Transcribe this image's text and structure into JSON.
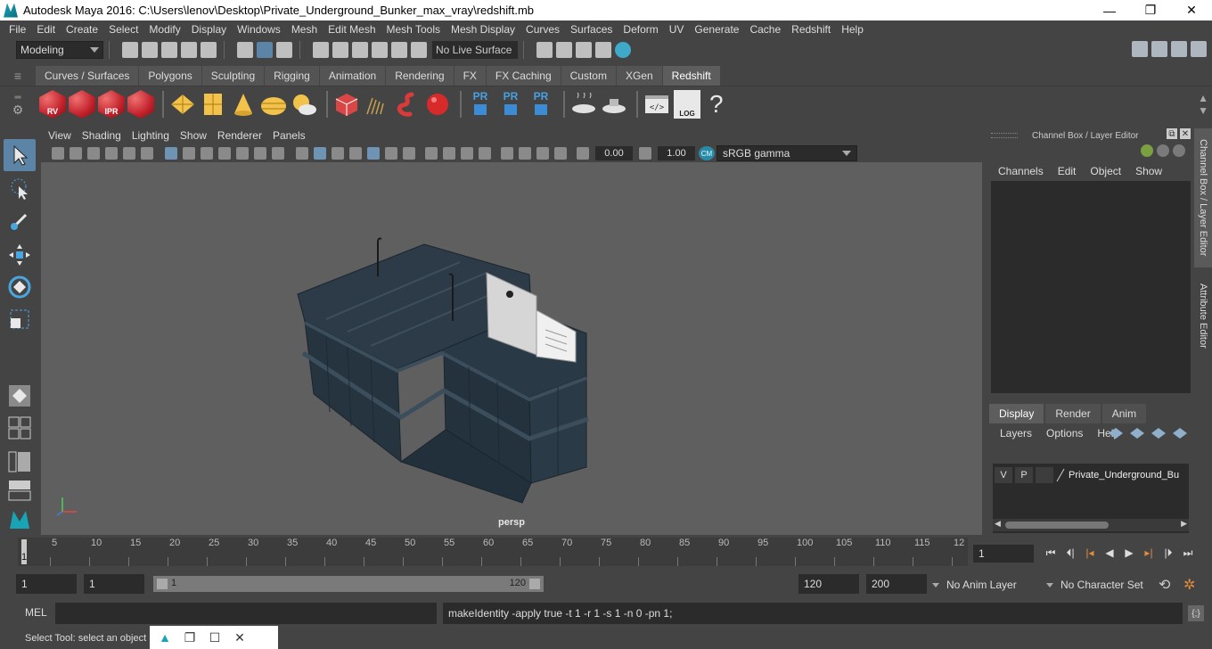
{
  "window": {
    "title": "Autodesk Maya 2016: C:\\Users\\lenov\\Desktop\\Private_Underground_Bunker_max_vray\\redshift.mb",
    "minimize": "—",
    "maximize": "❐",
    "close": "✕"
  },
  "menu": [
    "File",
    "Edit",
    "Create",
    "Select",
    "Modify",
    "Display",
    "Windows",
    "Mesh",
    "Edit Mesh",
    "Mesh Tools",
    "Mesh Display",
    "Curves",
    "Surfaces",
    "Deform",
    "UV",
    "Generate",
    "Cache",
    "Redshift",
    "Help"
  ],
  "status_line": {
    "mode": "Modeling",
    "live_surface": "No Live Surface"
  },
  "shelf_tabs": [
    "Curves / Surfaces",
    "Polygons",
    "Sculpting",
    "Rigging",
    "Animation",
    "Rendering",
    "FX",
    "FX Caching",
    "Custom",
    "XGen",
    "Redshift"
  ],
  "shelf_active": "Redshift",
  "shelf_labels": {
    "rv": "RV",
    "ipr": "IPR",
    "pr": "PR",
    "log": "LOG",
    "help": "?"
  },
  "panel_menu": [
    "View",
    "Shading",
    "Lighting",
    "Show",
    "Renderer",
    "Panels"
  ],
  "panel_toolbar": {
    "exposure": "0.00",
    "gamma": "1.00",
    "cm_badge": "CM",
    "color_space": "sRGB gamma"
  },
  "viewport": {
    "camera": "persp"
  },
  "channel_box": {
    "title": "Channel Box / Layer Editor",
    "menu": [
      "Channels",
      "Edit",
      "Object",
      "Show"
    ]
  },
  "layer_editor": {
    "tabs": [
      "Display",
      "Render",
      "Anim"
    ],
    "active_tab": "Display",
    "menu": [
      "Layers",
      "Options",
      "Help"
    ],
    "layer": {
      "v": "V",
      "p": "P",
      "name": "Private_Underground_Bu"
    }
  },
  "side_tabs": [
    "Channel Box / Layer Editor",
    "Attribute Editor"
  ],
  "time_slider": {
    "ticks": [
      "5",
      "10",
      "15",
      "20",
      "25",
      "30",
      "35",
      "40",
      "45",
      "50",
      "55",
      "60",
      "65",
      "70",
      "75",
      "80",
      "85",
      "90",
      "95",
      "100",
      "105",
      "110",
      "115",
      "12"
    ],
    "current": "1",
    "current_frame_field": "1"
  },
  "range": {
    "start": "1",
    "anim_start": "1",
    "range_start": "1",
    "range_end": "120",
    "end": "120",
    "anim_end": "200",
    "anim_layer": "No Anim Layer",
    "character_set": "No Character Set"
  },
  "command_line": {
    "language": "MEL",
    "result": "makeIdentity -apply true -t 1 -r 1 -s 1 -n 0 -pn 1;"
  },
  "help_line": "Select Tool: select an object",
  "colors": {
    "background": "#444444",
    "viewport": "#5f5f5f",
    "accent": "#5c84a6",
    "model": "#2c3c48"
  }
}
